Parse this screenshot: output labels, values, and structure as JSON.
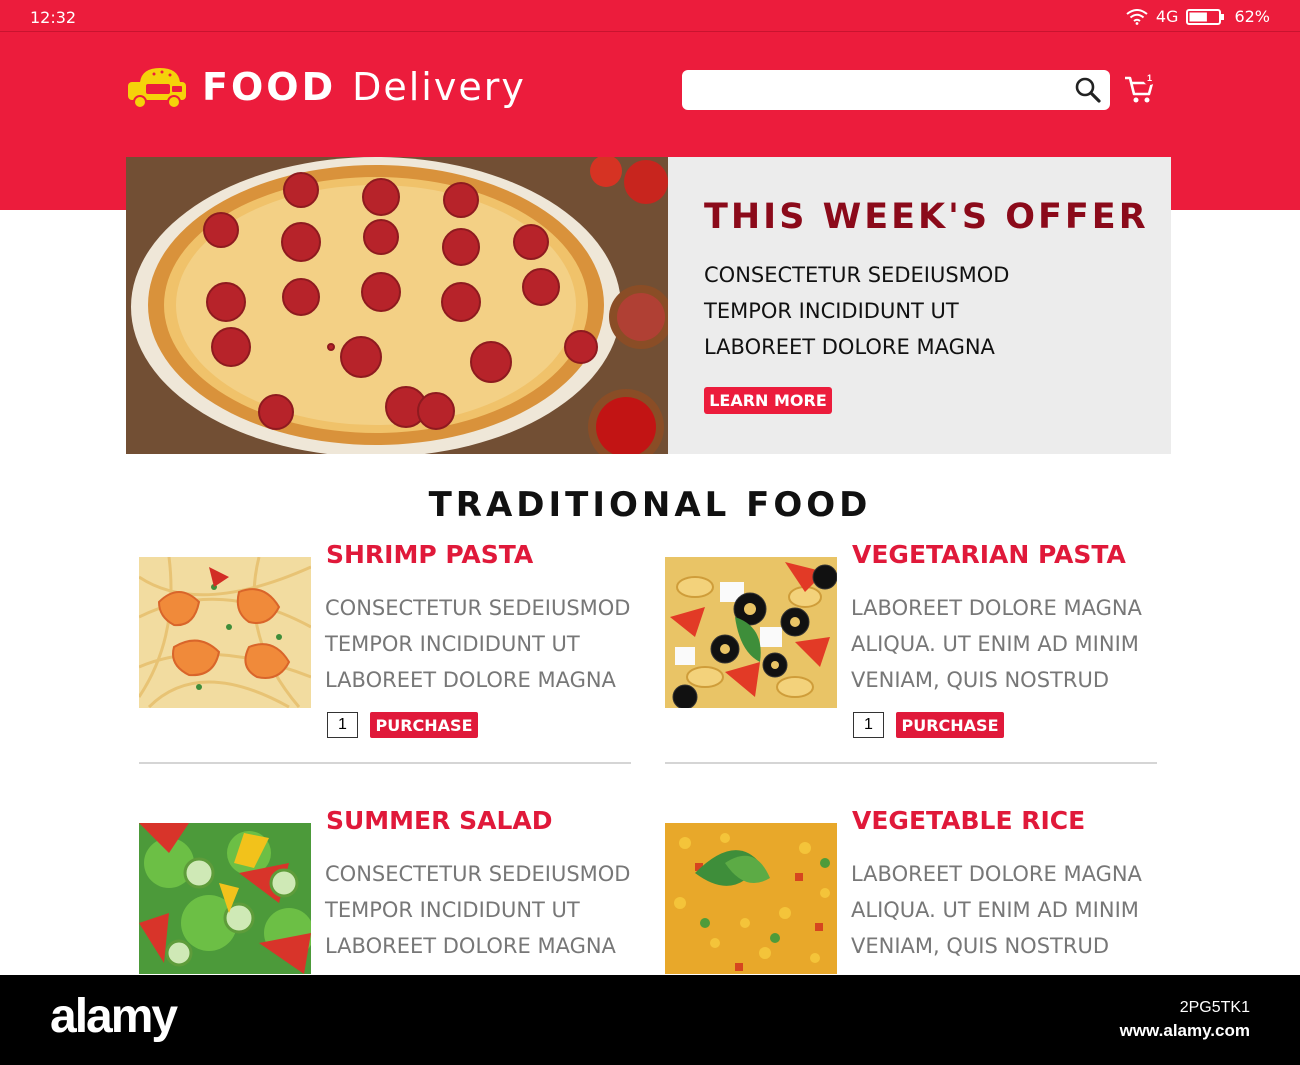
{
  "status_bar": {
    "time": "12:32",
    "network": "4G",
    "battery": "62%",
    "battery_level": 0.62
  },
  "header": {
    "brand_bold": "FOOD",
    "brand_light": "Delivery",
    "search": {
      "value": "",
      "placeholder": ""
    },
    "cart_count": "1"
  },
  "hero": {
    "title": "THIS WEEK'S OFFER",
    "lines": [
      "CONSECTETUR SEDEIUSMOD",
      "TEMPOR INCIDIDUNT UT",
      "LABOREET DOLORE MAGNA"
    ],
    "button": "LEARN MORE"
  },
  "section_title": "TRADITIONAL FOOD",
  "items": [
    {
      "name": "SHRIMP PASTA",
      "lines": [
        "CONSECTETUR SEDEIUSMOD",
        "TEMPOR INCIDIDUNT UT",
        "LABOREET DOLORE MAGNA"
      ],
      "qty": "1",
      "button": "PURCHASE"
    },
    {
      "name": "VEGETARIAN PASTA",
      "lines": [
        "LABOREET DOLORE MAGNA",
        "ALIQUA. UT ENIM AD MINIM",
        "VENIAM, QUIS NOSTRUD"
      ],
      "qty": "1",
      "button": "PURCHASE"
    },
    {
      "name": "SUMMER SALAD",
      "lines": [
        "CONSECTETUR SEDEIUSMOD",
        "TEMPOR INCIDIDUNT UT",
        "LABOREET DOLORE MAGNA"
      ]
    },
    {
      "name": "VEGETABLE RICE",
      "lines": [
        "LABOREET DOLORE MAGNA",
        "ALIQUA. UT ENIM AD MINIM",
        "VENIAM, QUIS NOSTRUD"
      ]
    }
  ],
  "watermark": {
    "logo": "alamy",
    "code": "2PG5TK1",
    "url": "www.alamy.com"
  },
  "colors": {
    "brand_red": "#ec1c3c",
    "offer_title": "#8b0a1a",
    "logo_yellow": "#f5d20a"
  }
}
